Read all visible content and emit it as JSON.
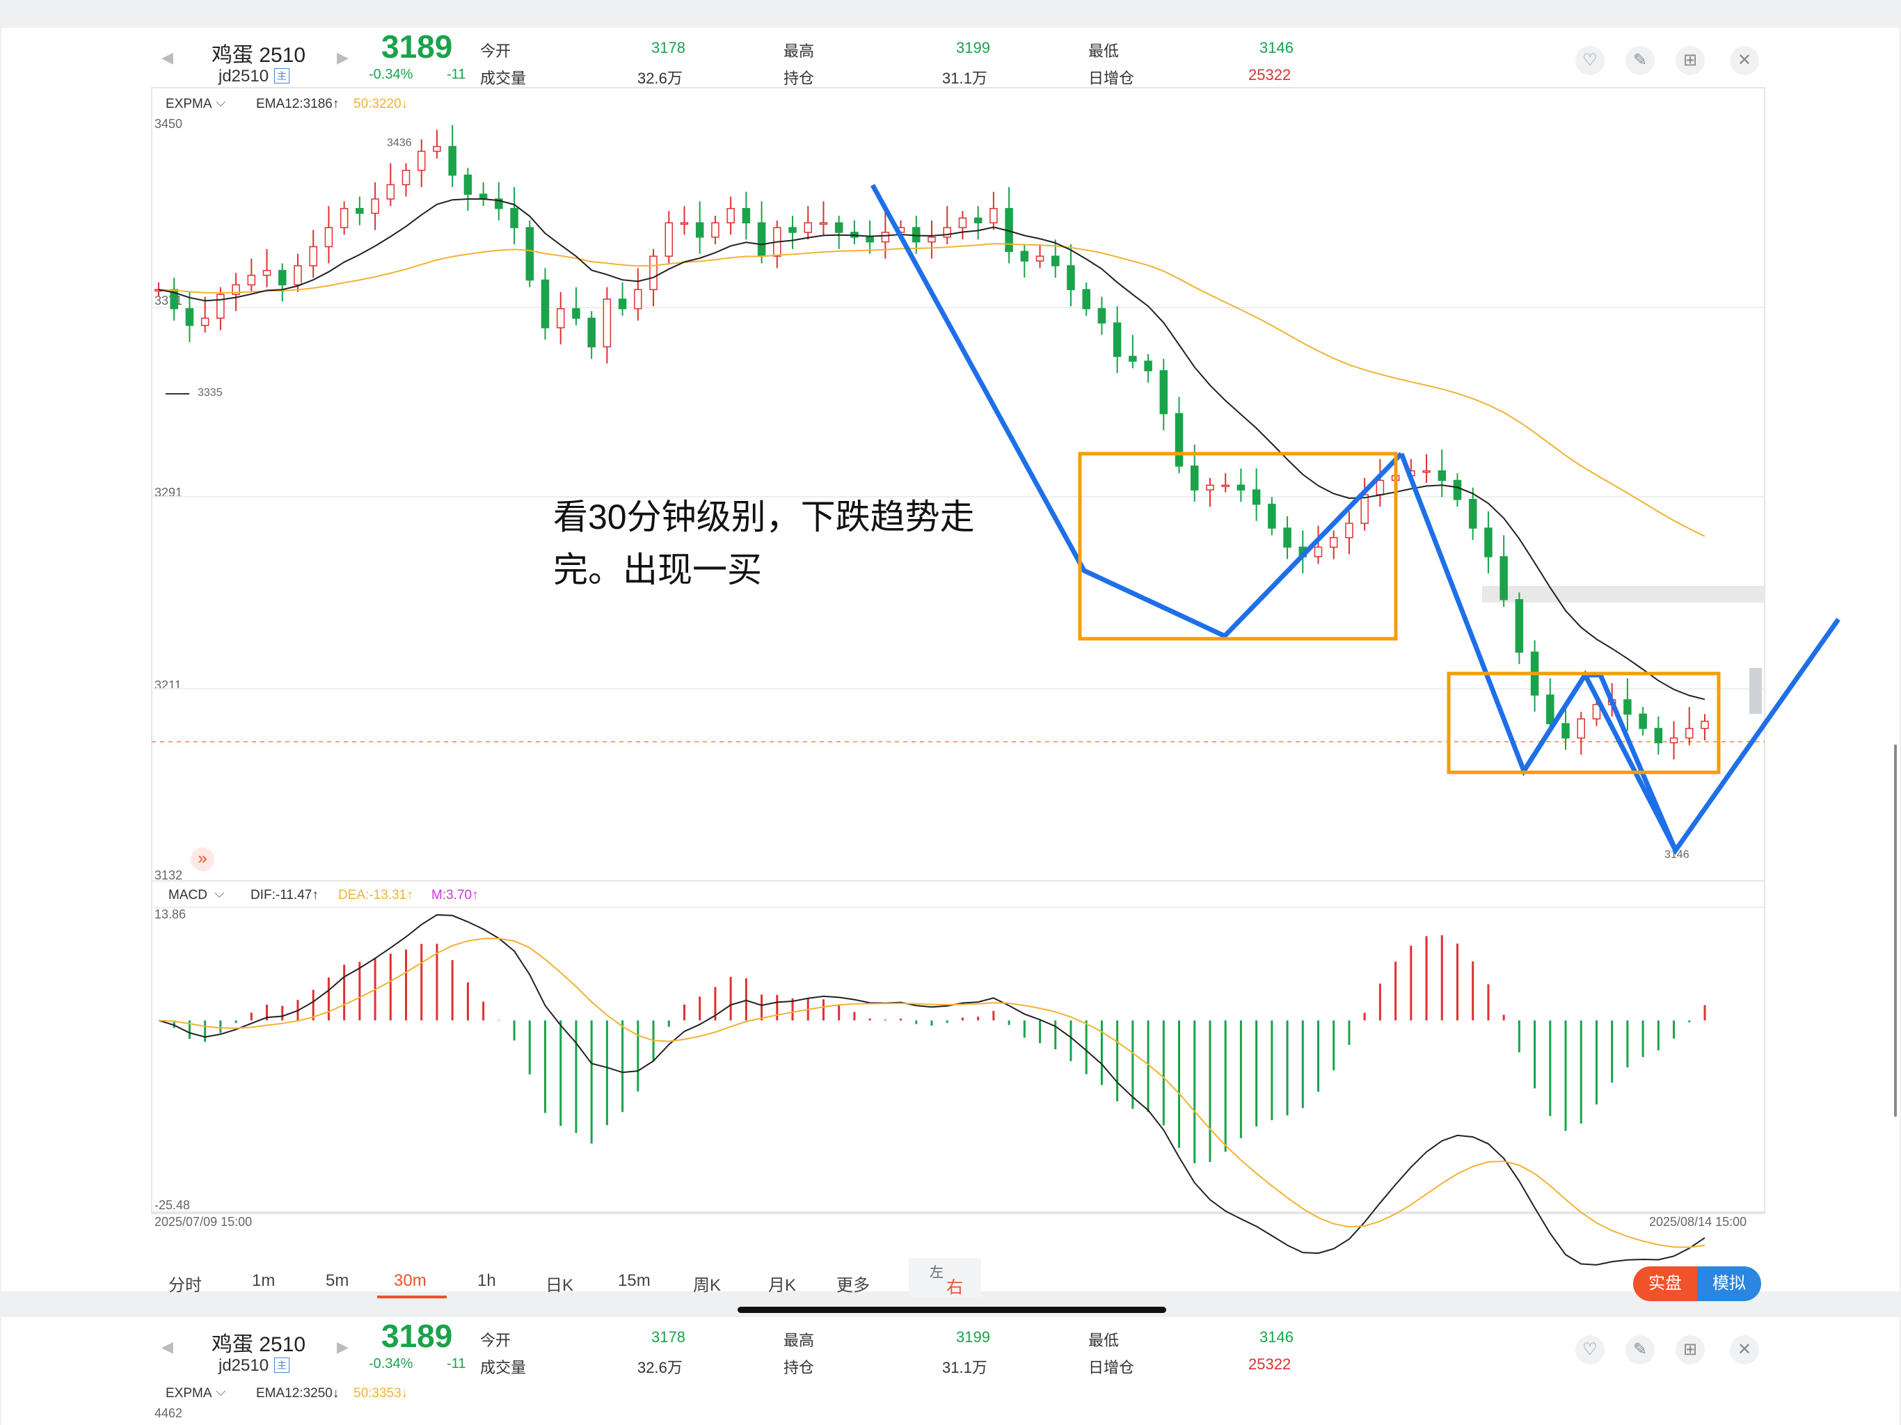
{
  "quote": {
    "name": "鸡蛋 2510",
    "code": "jd2510",
    "main_badge": "主",
    "price": "3189",
    "change_pct": "-0.34%",
    "change": "-11",
    "open_label": "今开",
    "open": "3178",
    "high_label": "最高",
    "high": "3199",
    "low_label": "最低",
    "low": "3146",
    "volume_label": "成交量",
    "volume": "32.6万",
    "oi_label": "持仓",
    "oi": "31.1万",
    "oi_change_label": "日增仓",
    "oi_change": "25322"
  },
  "icons": {
    "prev": "◀",
    "next": "▶",
    "favorite": "♡",
    "edit": "✎",
    "grid": "⊞",
    "close": "✕"
  },
  "main_indicator": {
    "name": "EXPMA",
    "ema12": "EMA12:3186↑",
    "ema50": "50:3220↓"
  },
  "price_axis": {
    "top": "3450",
    "l1": "3371",
    "l2": "3291",
    "l3": "3211",
    "bottom": "3132"
  },
  "annotations": {
    "high_label": "3436",
    "low_left": "3335",
    "low_right": "3146",
    "note_line1": "看30分钟级别，下跌趋势走",
    "note_line2": "完。出现一买",
    "expand": "»"
  },
  "macd": {
    "name": "MACD",
    "dif": "DIF:-11.47↑",
    "dea": "DEA:-13.31↑",
    "m": "M:3.70↑",
    "top": "13.86",
    "bottom": "-25.48"
  },
  "time_axis": {
    "start": "2025/07/09 15:00",
    "end": "2025/08/14 15:00"
  },
  "tabs": [
    "分时",
    "1m",
    "5m",
    "30m",
    "1h",
    "日K",
    "15m",
    "周K",
    "月K",
    "更多"
  ],
  "active_tab": "30m",
  "side_toggle": {
    "left": "左",
    "right": "右"
  },
  "mode_buttons": {
    "real": "实盘",
    "sim": "模拟"
  },
  "second_panel": {
    "ema12": "EMA12:3250↓",
    "ema50": "50:3353↓",
    "axis_top": "4462"
  },
  "colors": {
    "up": "#e03030",
    "down": "#1aa34a",
    "ema50": "#f2b233",
    "annotation_line": "#1e6fe8",
    "annotation_box": "#f59c0c",
    "accent": "#e8532f"
  },
  "chart_data": [
    {
      "type": "candlestick",
      "title": "鸡蛋 2510 30m",
      "x_range": [
        "2025/07/09 15:00",
        "2025/08/14 15:00"
      ],
      "ylim": [
        3132,
        3450
      ],
      "series": [
        {
          "name": "EMA12",
          "last": 3186
        },
        {
          "name": "50",
          "last": 3220
        }
      ],
      "annotated_points": [
        {
          "label": "3436",
          "y": 3436
        },
        {
          "label": "3335",
          "y": 3335
        },
        {
          "label": "3146",
          "y": 3146
        }
      ],
      "close_approx": [
        3370,
        3362,
        3355,
        3358,
        3368,
        3372,
        3376,
        3378,
        3372,
        3380,
        3388,
        3396,
        3404,
        3402,
        3408,
        3414,
        3420,
        3428,
        3430,
        3418,
        3410,
        3408,
        3404,
        3396,
        3374,
        3354,
        3362,
        3358,
        3346,
        3366,
        3362,
        3370,
        3384,
        3398,
        3398,
        3392,
        3398,
        3404,
        3398,
        3384,
        3396,
        3394,
        3398,
        3398,
        3394,
        3392,
        3390,
        3394,
        3396,
        3390,
        3392,
        3396,
        3400,
        3398,
        3404,
        3386,
        3382,
        3384,
        3380,
        3370,
        3362,
        3356,
        3342,
        3340,
        3336,
        3318,
        3296,
        3286,
        3288,
        3288,
        3286,
        3280,
        3270,
        3262,
        3258,
        3262,
        3266,
        3272,
        3284,
        3290,
        3292,
        3294,
        3294,
        3290,
        3282,
        3270,
        3258,
        3240,
        3218,
        3200,
        3188,
        3182,
        3190,
        3196,
        3198,
        3192,
        3186,
        3180,
        3182,
        3186,
        3189
      ]
    },
    {
      "type": "bar",
      "title": "MACD",
      "ylim": [
        -25.48,
        13.86
      ],
      "series": [
        {
          "name": "DIF",
          "last": -11.47
        },
        {
          "name": "DEA",
          "last": -13.31
        },
        {
          "name": "M",
          "last": 3.7
        }
      ]
    }
  ]
}
